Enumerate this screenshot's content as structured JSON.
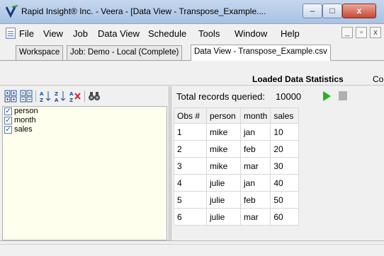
{
  "window": {
    "title": "Rapid Insight® Inc. - Veera - [Data View - Transpose_Example....",
    "controls": {
      "minimize": "–",
      "maximize": "□",
      "close": "x"
    }
  },
  "menu": {
    "items": [
      "File",
      "View",
      "Job",
      "Data View",
      "Schedule",
      "Tools",
      "Window",
      "Help"
    ],
    "mdi": {
      "minimize": "_",
      "restore": "▫",
      "close": "x"
    }
  },
  "tabs": [
    {
      "label": "Workspace"
    },
    {
      "label": "Job: Demo - Local (Complete)"
    },
    {
      "label": "Data View - Transpose_Example.csv"
    }
  ],
  "banner": {
    "title": "Loaded Data Statistics",
    "cut": "Co"
  },
  "toolbar": {
    "icons": [
      "expand-all-icon",
      "collapse-all-icon",
      "sort-ascending-icon",
      "sort-descending-icon",
      "clear-sort-icon",
      "find-icon"
    ]
  },
  "fields": [
    {
      "label": "person",
      "checked": true
    },
    {
      "label": "month",
      "checked": true
    },
    {
      "label": "sales",
      "checked": true
    }
  ],
  "records": {
    "label": "Total records queried:",
    "value": "10000"
  },
  "table": {
    "headers": [
      "Obs #",
      "person",
      "month",
      "sales"
    ],
    "rows": [
      [
        "1",
        "mike",
        "jan",
        "10"
      ],
      [
        "2",
        "mike",
        "feb",
        "20"
      ],
      [
        "3",
        "mike",
        "mar",
        "30"
      ],
      [
        "4",
        "julie",
        "jan",
        "40"
      ],
      [
        "5",
        "julie",
        "feb",
        "50"
      ],
      [
        "6",
        "julie",
        "mar",
        "60"
      ]
    ]
  },
  "colors": {
    "play": "#22b322",
    "field_list_bg": "#ffffee"
  }
}
